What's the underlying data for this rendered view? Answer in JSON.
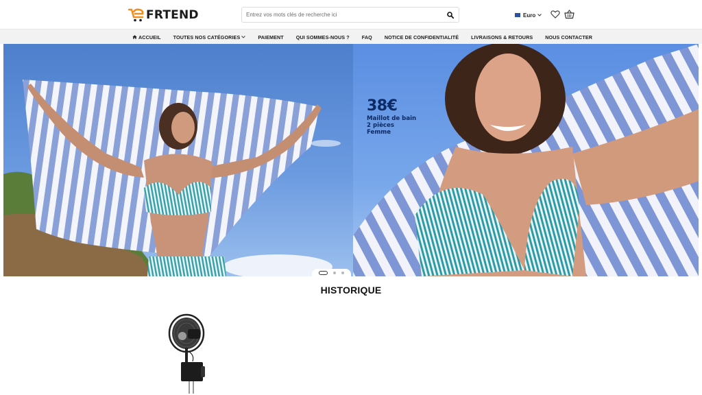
{
  "brand": {
    "logo_text": "FRTEND",
    "accent_color": "#f28c1c"
  },
  "search": {
    "placeholder": "Entrez vos mots clés de recherche ici",
    "icon": "search-icon"
  },
  "header": {
    "currency_label": "Euro",
    "wishlist_icon": "heart-icon",
    "cart_icon": "basket-icon"
  },
  "nav": {
    "items": [
      {
        "label": "ACCUEIL",
        "icon": "home-icon"
      },
      {
        "label": "TOUTES NOS CATÉGORIES",
        "icon": "chevron-down-icon"
      },
      {
        "label": "PAIEMENT"
      },
      {
        "label": "QUI SOMMES-NOUS ?"
      },
      {
        "label": "FAQ"
      },
      {
        "label": "NOTICE DE CONFIDENTIALITÉ"
      },
      {
        "label": "LIVRAISONS & RETOURS"
      },
      {
        "label": "NOUS CONTACTER"
      }
    ]
  },
  "hero": {
    "price": "38€",
    "caption_lines": [
      "Maillot de bain",
      "2 pièces",
      "Femme"
    ],
    "slide_count": 3,
    "active_slide": 1
  },
  "history": {
    "title": "HISTORIQUE"
  }
}
